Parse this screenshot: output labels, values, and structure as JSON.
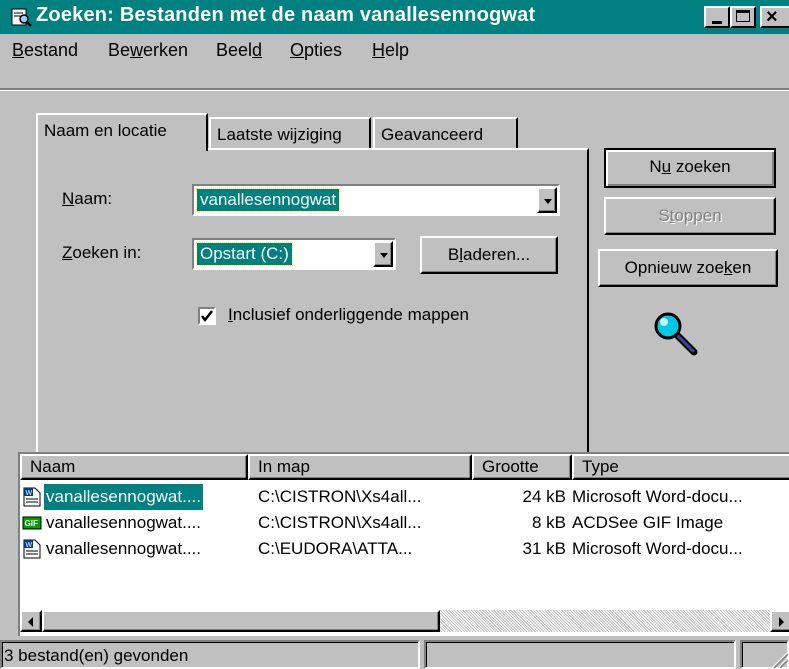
{
  "window": {
    "title": "Zoeken: Bestanden met de naam vanallesennogwat",
    "accent": "#008080",
    "face": "#c0c0c0"
  },
  "menu": [
    {
      "label": "Bestand",
      "mnemonic": "B"
    },
    {
      "label": "Bewerken",
      "mnemonic": "w"
    },
    {
      "label": "Beeld",
      "mnemonic": "d"
    },
    {
      "label": "Opties",
      "mnemonic": "O"
    },
    {
      "label": "Help",
      "mnemonic": "H"
    }
  ],
  "tabs": [
    {
      "label": "Naam en locatie",
      "active": true
    },
    {
      "label": "Laatste wijziging",
      "active": false
    },
    {
      "label": "Geavanceerd",
      "active": false
    }
  ],
  "form": {
    "name_label": "Naam:",
    "name_value": "vanallesennogwat",
    "lookin_label": "Zoeken in:",
    "lookin_value": "Opstart (C:)",
    "browse_label": "Bladeren...",
    "subfolders_label": "Inclusief onderliggende mappen",
    "subfolders_checked": true
  },
  "actions": {
    "search_now": "Nu zoeken",
    "stop": "Stoppen",
    "new_search": "Opnieuw zoeken",
    "magnifier_icon": "magnifier-icon"
  },
  "results": {
    "columns": [
      "Naam",
      "In map",
      "Grootte",
      "Type"
    ],
    "rows": [
      {
        "name": "vanallesennogwat....",
        "folder": "C:\\CISTRON\\Xs4all...",
        "size": "24 kB",
        "type": "Microsoft Word-docu...",
        "icon": "word-doc-icon",
        "selected": true
      },
      {
        "name": "vanallesennogwat....",
        "folder": "C:\\CISTRON\\Xs4all...",
        "size": "8 kB",
        "type": "ACDSee GIF Image",
        "icon": "gif-image-icon",
        "selected": false
      },
      {
        "name": "vanallesennogwat....",
        "folder": "C:\\EUDORA\\ATTA...",
        "size": "31 kB",
        "type": "Microsoft Word-docu...",
        "icon": "word-doc-icon",
        "selected": false
      }
    ]
  },
  "status": {
    "text": "3 bestand(en) gevonden"
  }
}
